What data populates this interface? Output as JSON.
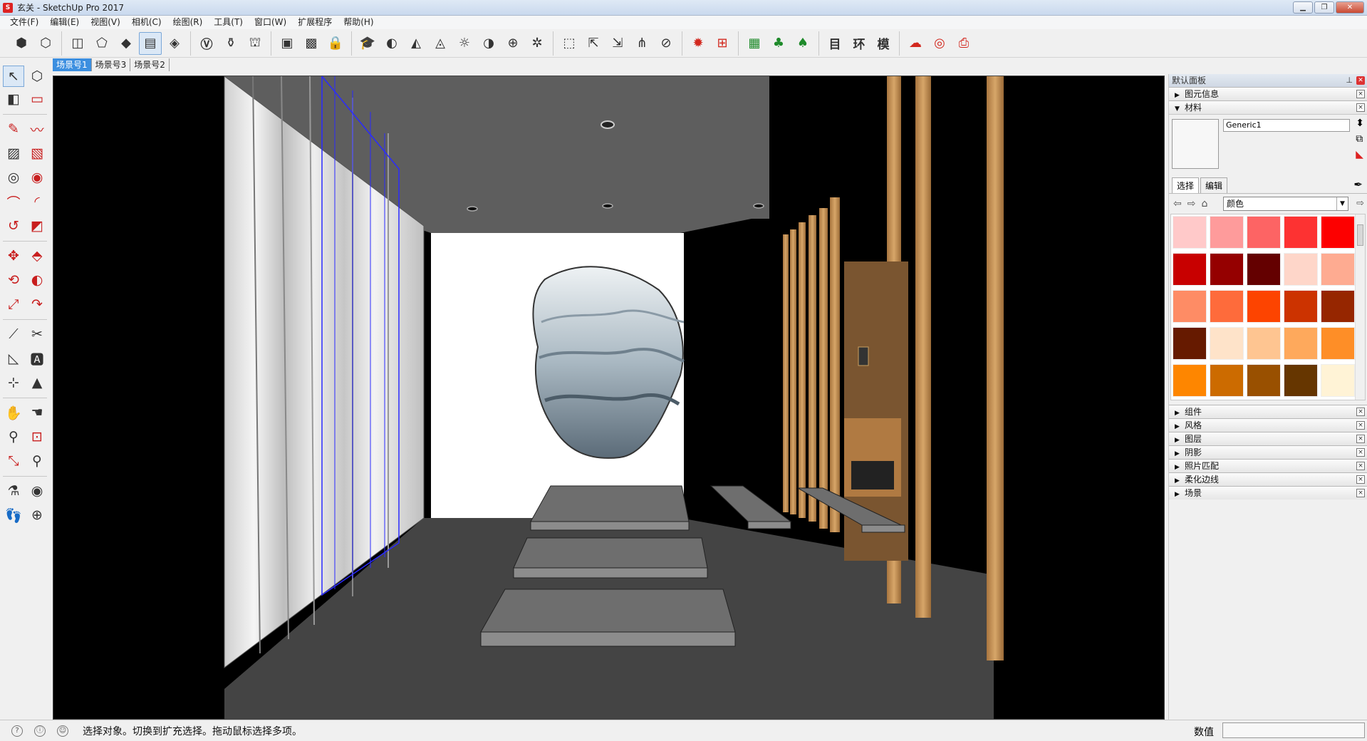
{
  "window": {
    "title": "玄关 - SketchUp Pro 2017",
    "app_icon": "S"
  },
  "window_buttons": [
    "▁",
    "❐",
    "✕"
  ],
  "menu": [
    "文件(F)",
    "编辑(E)",
    "视图(V)",
    "相机(C)",
    "绘图(R)",
    "工具(T)",
    "窗口(W)",
    "扩展程序",
    "帮助(H)"
  ],
  "scene_tabs": [
    "场景号1",
    "场景号3",
    "场景号2"
  ],
  "toolbar_groups": [
    [
      "⬢",
      "⬡"
    ],
    [
      "◫",
      "⬠",
      "◆",
      "▤",
      "◈"
    ],
    [
      "Ⓥ",
      "⚱",
      "⛫"
    ],
    [
      "▣",
      "▩",
      "🔒"
    ],
    [
      "🎓",
      "◐",
      "◭",
      "◬",
      "☼",
      "◑",
      "⊕",
      "✲"
    ],
    [
      "⬚",
      "⇱",
      "⇲",
      "⋔",
      "⊘"
    ],
    [
      "✹",
      "⊞"
    ],
    [
      "▦",
      "♣",
      "♠"
    ],
    [
      "目",
      "环",
      "模"
    ],
    [
      "☁",
      "◎",
      "⎙"
    ]
  ],
  "left_tools": [
    "↖",
    "⬡",
    "◧",
    "▭",
    "✎",
    "〰",
    "▨",
    "▧",
    "◎",
    "◉",
    "⌒",
    "◜",
    "↺",
    "◩",
    "✥",
    "⬘",
    "⟲",
    "◐",
    "⤢",
    "↷",
    "⟋",
    "✂",
    "◺",
    "🅰",
    "⊹",
    "▲",
    "✋",
    "☚",
    "⚲",
    "⊡",
    "⤡",
    "⚲",
    "⚗",
    "◉",
    "👣",
    "⊕"
  ],
  "panel": {
    "title": "默认面板",
    "tray_entity": "图元信息",
    "tray_materials": "材料",
    "material_name": "Generic1",
    "tab_select": "选择",
    "tab_edit": "编辑",
    "collection": "颜色",
    "swatch_colors": [
      "#ffc9c9",
      "#fe9b9b",
      "#fd6464",
      "#fd3232",
      "#fd0000",
      "#c80000",
      "#950000",
      "#640000",
      "#fed6c9",
      "#feab91",
      "#fe8c65",
      "#fe6b3b",
      "#fd4400",
      "#cc3300",
      "#962600",
      "#661a00",
      "#fee3c9",
      "#fec591",
      "#fea95c",
      "#fe8e27",
      "#fe8600",
      "#cc6b00",
      "#995000",
      "#663600",
      "#fff3d6"
    ],
    "trays": [
      "组件",
      "风格",
      "图层",
      "阴影",
      "照片匹配",
      "柔化边线",
      "场景"
    ]
  },
  "status": {
    "message": "选择对象。切换到扩充选择。拖动鼠标选择多项。",
    "vcb_label": "数值",
    "icons": [
      "?",
      "ⓘ",
      "☺"
    ]
  }
}
